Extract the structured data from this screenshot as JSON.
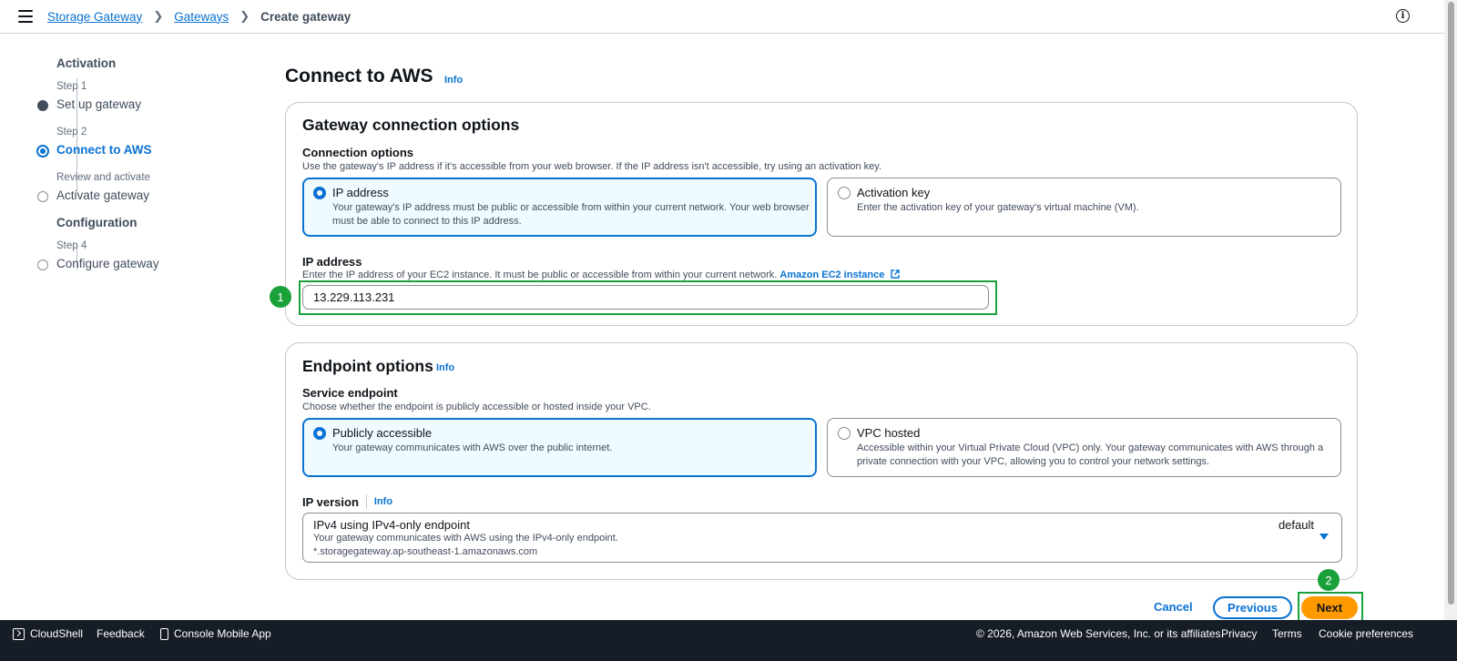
{
  "breadcrumb": {
    "items": [
      "Storage Gateway",
      "Gateways"
    ],
    "current": "Create gateway"
  },
  "nav": {
    "group1_title": "Activation",
    "group2_title": "Configuration",
    "steps": [
      {
        "label": "Step 1",
        "title": "Set up gateway",
        "state": "done"
      },
      {
        "label": "Step 2",
        "title": "Connect to AWS",
        "state": "active"
      },
      {
        "label": "Review and activate",
        "title": "Activate gateway",
        "state": "pending"
      },
      {
        "label": "Step 4",
        "title": "Configure gateway",
        "state": "pending"
      }
    ]
  },
  "page": {
    "title": "Connect to AWS",
    "info": "Info"
  },
  "connection": {
    "card_title": "Gateway connection options",
    "label": "Connection options",
    "description": "Use the gateway's IP address if it's accessible from your web browser. If the IP address isn't accessible, try using an activation key.",
    "options": [
      {
        "title": "IP address",
        "desc_line1": "Your gateway's IP address must be public or accessible from within your current network. Your web browser",
        "desc_line2": "must be able to connect to this IP address.",
        "selected": true
      },
      {
        "title": "Activation key",
        "desc_line1": "Enter the activation key of your gateway's virtual machine (VM).",
        "desc_line2": "",
        "selected": false
      }
    ],
    "ip_label": "IP address",
    "ip_description": "Enter the IP address of your EC2 instance. It must be public or accessible from within your current network.",
    "ip_link": "Amazon EC2 instance",
    "ip_value": "13.229.113.231"
  },
  "endpoint": {
    "card_title": "Endpoint options",
    "info": "Info",
    "label": "Service endpoint",
    "description": "Choose whether the endpoint is publicly accessible or hosted inside your VPC.",
    "options": [
      {
        "title": "Publicly accessible",
        "desc_line1": "Your gateway communicates with AWS over the public internet.",
        "desc_line2": "",
        "selected": true
      },
      {
        "title": "VPC hosted",
        "desc_line1": "Accessible within your Virtual Private Cloud (VPC) only. Your gateway communicates with AWS through a",
        "desc_line2": "private connection with your VPC, allowing you to control your network settings.",
        "selected": false
      }
    ],
    "ip_version_label": "IP version",
    "ip_version_info": "Info",
    "ip_version_value": "IPv4 using IPv4-only endpoint",
    "ip_version_desc": "Your gateway communicates with AWS using the IPv4-only endpoint.",
    "ip_version_endpoint": "*.storagegateway.ap-southeast-1.amazonaws.com",
    "ip_version_tag": "default"
  },
  "actions": {
    "cancel": "Cancel",
    "previous": "Previous",
    "next": "Next"
  },
  "annotations": {
    "badge1": "1",
    "badge2": "2",
    "color": "#1aa13a"
  },
  "footer": {
    "cloudshell": "CloudShell",
    "feedback": "Feedback",
    "mobile_app": "Console Mobile App",
    "copyright": "© 2026, Amazon Web Services, Inc. or its affiliates.",
    "privacy": "Privacy",
    "terms": "Terms",
    "cookies": "Cookie preferences"
  },
  "colors": {
    "accent": "#0972d3",
    "primary_button": "#ff9900",
    "footer_bg": "#161d26"
  }
}
